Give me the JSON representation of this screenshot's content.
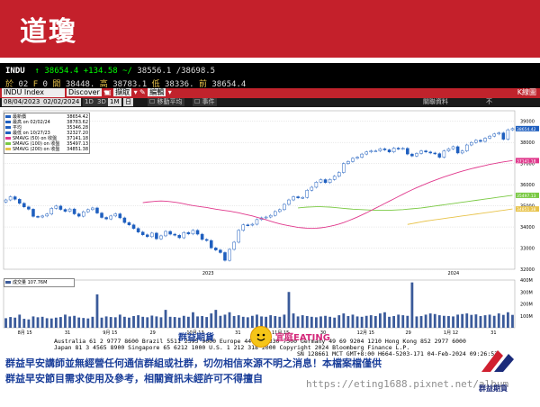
{
  "banner": {
    "title": "道瓊"
  },
  "quote": {
    "ticker": "INDU",
    "last": "38654.4",
    "change": "+134.58",
    "range_low": "38556.1",
    "range_high": "38698.5",
    "row2": [
      {
        "label": "於",
        "value": "02"
      },
      {
        "label": "F",
        "value": "0"
      },
      {
        "label": "開",
        "value": "38448."
      },
      {
        "label": "高",
        "value": "38783.1"
      },
      {
        "label": "低",
        "value": "38336."
      },
      {
        "label": "前",
        "value": "38654.4"
      }
    ]
  },
  "toolbar": {
    "security": "INDU Index",
    "discover": "Discover",
    "action": "擷取",
    "edit": "編輯",
    "right": "K線圖"
  },
  "subbar": {
    "start": "08/04/2023",
    "end": "02/02/2024",
    "periods": [
      "1D",
      "3D",
      "1M",
      "6M",
      "YTD",
      "1Y",
      "5Y",
      "最大"
    ],
    "freq": "日",
    "mode1": "移動平均",
    "mode2": "事件",
    "right_a": "關聯資料",
    "right_b": "不"
  },
  "chart_data": {
    "type": "line",
    "legend": [
      {
        "name": "最新價",
        "value": "38654.42",
        "color": "#1f5fbf"
      },
      {
        "name": "最高 on 02/02/24",
        "value": "38783.62",
        "color": "#1f5fbf"
      },
      {
        "name": "平均",
        "value": "35346.28",
        "color": "#1f5fbf"
      },
      {
        "name": "最低 on 10/27/23",
        "value": "32327.20",
        "color": "#1f5fbf"
      },
      {
        "name": "SMAVG (50) on 收盤",
        "value": "37141.18",
        "color": "#e0388c"
      },
      {
        "name": "SMAVG (100) on 收盤",
        "value": "35497.13",
        "color": "#7ac943"
      },
      {
        "name": "SMAVG (200) on 收盤",
        "value": "34851.38",
        "color": "#e8c34a"
      }
    ],
    "ylim": [
      32000,
      39500
    ],
    "y_ticks": [
      "39000",
      "38000",
      "37000",
      "36000",
      "35000",
      "34000",
      "33000",
      "32000"
    ],
    "price_tags": [
      {
        "value": "38654.42",
        "color": "#1f5fbf"
      },
      {
        "value": "37141.18",
        "color": "#e0388c"
      },
      {
        "value": "35497.13",
        "color": "#7ac943"
      },
      {
        "value": "34851.38",
        "color": "#e8c34a"
      }
    ],
    "x_ticks": [
      "8月 15",
      "31",
      "9月 15",
      "29",
      "10月 13",
      "31",
      "11月 15",
      "30",
      "12月 15",
      "29",
      "1月 12",
      "31"
    ],
    "x_years": [
      "2023",
      "2024"
    ],
    "closes": [
      35280,
      35430,
      35310,
      35120,
      34950,
      34840,
      34500,
      34470,
      34520,
      34610,
      34880,
      34990,
      34830,
      34740,
      34850,
      34620,
      34510,
      34720,
      34820,
      34900,
      34660,
      34450,
      34380,
      34520,
      34620,
      34430,
      34210,
      34100,
      33930,
      33760,
      33630,
      33540,
      33710,
      33440,
      33580,
      33790,
      33660,
      33610,
      33490,
      33740,
      33670,
      33840,
      33660,
      33410,
      33360,
      33010,
      32910,
      32790,
      32420,
      32940,
      33280,
      33840,
      34100,
      34090,
      34130,
      34350,
      34430,
      34470,
      34550,
      34730,
      34820,
      35070,
      35280,
      35430,
      35380,
      35400,
      35740,
      35880,
      36120,
      36240,
      36100,
      36250,
      36400,
      36580,
      37000,
      37100,
      37250,
      37300,
      37450,
      37550,
      37600,
      37600,
      37700,
      37650,
      37550,
      37730,
      37700,
      37720,
      37450,
      37360,
      37480,
      37600,
      37550,
      37500,
      37470,
      37300,
      37600,
      37700,
      37800,
      37500,
      37600,
      37880,
      38000,
      38100,
      38050,
      38200,
      38300,
      38400,
      38450,
      38150,
      38600,
      38654
    ],
    "sma50": [
      35150,
      35180,
      35200,
      35220,
      35230,
      35220,
      35200,
      35170,
      35140,
      35100,
      35050,
      35010,
      34980,
      34950,
      34920,
      34880,
      34840,
      34810,
      34780,
      34750,
      34710,
      34670,
      34620,
      34570,
      34520,
      34460,
      34400,
      34340,
      34270,
      34210,
      34150,
      34100,
      34060,
      34020,
      33980,
      33960,
      33940,
      33930,
      33940,
      33960,
      33990,
      34030,
      34080,
      34140,
      34210,
      34290,
      34380,
      34470,
      34570,
      34670,
      34780,
      34890,
      35000,
      35110,
      35220,
      35330,
      35440,
      35550,
      35660,
      35760,
      35860,
      35950,
      36040,
      36130,
      36210,
      36290,
      36370,
      36440,
      36510,
      36580,
      36640,
      36700,
      36760,
      36810,
      36860,
      36910,
      36960,
      37000,
      37040,
      37080,
      37110,
      37141
    ],
    "sma100": [
      34900,
      34920,
      34940,
      34950,
      34960,
      34960,
      34950,
      34940,
      34920,
      34900,
      34880,
      34860,
      34840,
      34830,
      34820,
      34810,
      34800,
      34790,
      34790,
      34790,
      34790,
      34800,
      34810,
      34820,
      34840,
      34860,
      34880,
      34900,
      34930,
      34960,
      34990,
      35020,
      35050,
      35080,
      35110,
      35140,
      35170,
      35200,
      35230,
      35260,
      35290,
      35320,
      35350,
      35380,
      35410,
      35440,
      35470,
      35497
    ],
    "sma200": [
      34120,
      34160,
      34200,
      34240,
      34280,
      34310,
      34340,
      34370,
      34400,
      34430,
      34460,
      34490,
      34520,
      34550,
      34580,
      34610,
      34640,
      34670,
      34700,
      34730,
      34760,
      34790,
      34820,
      34851
    ],
    "volume_ticks": [
      "400M",
      "300M",
      "200M",
      "100M"
    ],
    "volume_legend": "成交量  107.76M",
    "volumes": [
      80,
      90,
      85,
      110,
      75,
      70,
      95,
      88,
      92,
      80,
      78,
      85,
      90,
      110,
      95,
      100,
      86,
      82,
      78,
      92,
      280,
      85,
      95,
      90,
      88,
      110,
      92,
      85,
      98,
      105,
      92,
      88,
      102,
      95,
      88,
      150,
      92,
      90,
      85,
      100,
      92,
      130,
      95,
      98,
      90,
      120,
      150,
      100,
      110,
      130,
      98,
      105,
      92,
      88,
      100,
      110,
      95,
      92,
      105,
      98,
      92,
      110,
      300,
      120,
      95,
      105,
      98,
      92,
      88,
      95,
      100,
      92,
      85,
      105,
      120,
      98,
      110,
      95,
      92,
      100,
      105,
      98,
      120,
      130,
      92,
      98,
      110,
      105,
      100,
      380,
      95,
      98,
      110,
      120,
      115,
      105,
      100,
      98,
      95,
      110,
      115,
      120,
      108,
      112,
      98,
      105,
      110,
      100,
      120,
      108,
      130,
      108
    ]
  },
  "footer": {
    "line1": "Australia 61 2 9777 8600 Brazil 5511 2395 9000 Europe 44 20 7330 7500 Germany 49 69 9204 1210 Hong Kong 852 2977 6000",
    "line2": "Japan 81 3 4565 8900      Singapore 65 6212 1000      U.S. 1 212 318 2000            Copyright 2024 Bloomberg Finance L.P.",
    "line3": "SN 128661 MCT  GMT+8:00 H664-5203-171 04-Feb-2024 09:26:53"
  },
  "brand": {
    "left": "群益期貨",
    "right": "宜庭EATING"
  },
  "disclaimer": {
    "line1": "群益早安講師並無經營任何通信群組或社群，切勿相信來源不明之消息！本檔案檔僅供",
    "line2": "群益早安節目需求使用及參考，相關資訊未經許可不得擅自"
  },
  "watermark": "https://eting1688.pixnet.net/album",
  "logo": {
    "text": "群益期貨"
  }
}
